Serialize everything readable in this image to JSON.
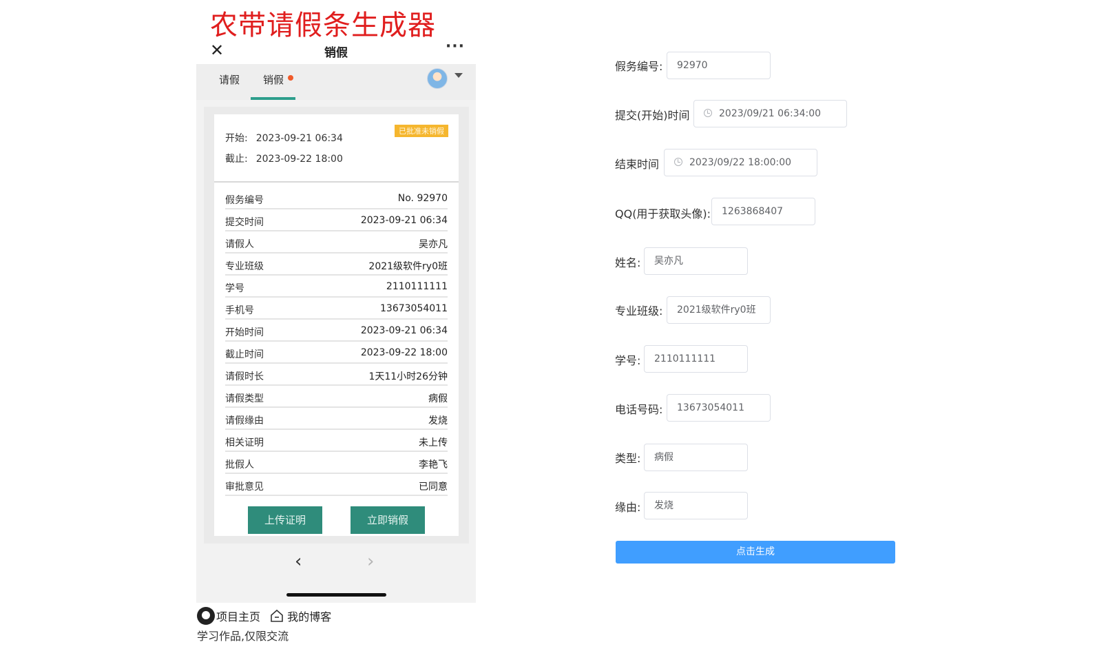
{
  "app": {
    "title": "农带请假条生成器"
  },
  "wechat_bar": {
    "close_icon": "close-icon",
    "title": "销假",
    "more": "···"
  },
  "tabs": [
    {
      "label": "请假"
    },
    {
      "label": "销假",
      "has_dot": true,
      "active": true
    }
  ],
  "card": {
    "start_label": "开始:",
    "start_value": "2023-09-21 06:34",
    "end_label": "截止:",
    "end_value": "2023-09-22 18:00",
    "status_badge": "已批准未销假",
    "rows": [
      {
        "label": "假务编号",
        "value": "No. 92970"
      },
      {
        "label": "提交时间",
        "value": "2023-09-21  06:34"
      },
      {
        "label": "请假人",
        "value": "吴亦凡"
      },
      {
        "label": "专业班级",
        "value": "2021级软件ry0班"
      },
      {
        "label": "学号",
        "value": "2110111111"
      },
      {
        "label": "手机号",
        "value": "13673054011"
      },
      {
        "label": "开始时间",
        "value": "2023-09-21  06:34"
      },
      {
        "label": "截止时间",
        "value": "2023-09-22  18:00"
      },
      {
        "label": "请假时长",
        "value": "1天11小时26分钟"
      },
      {
        "label": "请假类型",
        "value": "病假"
      },
      {
        "label": "请假缘由",
        "value": "发烧"
      },
      {
        "label": "相关证明",
        "value": "未上传"
      },
      {
        "label": "批假人",
        "value": "李艳飞"
      },
      {
        "label": "审批意见",
        "value": "已同意"
      }
    ],
    "upload_button": "上传证明",
    "cancel_leave_button": "立即销假"
  },
  "nav": {
    "back": "‹",
    "forward": "›"
  },
  "footer": {
    "project_link": "项目主页",
    "blog_link": "我的博客",
    "disclaimer": "学习作品,仅限交流"
  },
  "form": {
    "leave_no": {
      "label": "假务编号:",
      "value": "92970"
    },
    "submit_time": {
      "label": "提交(开始)时间",
      "value": "2023/09/21 06:34:00"
    },
    "end_time": {
      "label": "结束时间",
      "value": "2023/09/22 18:00:00"
    },
    "qq": {
      "label": "QQ(用于获取头像):",
      "value": "1263868407"
    },
    "name": {
      "label": "姓名:",
      "value": "吴亦凡"
    },
    "class": {
      "label": "专业班级:",
      "value": "2021级软件ry0班"
    },
    "student_id": {
      "label": "学号:",
      "value": "2110111111"
    },
    "phone": {
      "label": "电话号码:",
      "value": "13673054011"
    },
    "type": {
      "label": "类型:",
      "value": "病假"
    },
    "reason": {
      "label": "缘由:",
      "value": "发烧"
    },
    "generate_button": "点击生成"
  },
  "colors": {
    "title_red": "#e01e1e",
    "accent_green": "#2f8c7b",
    "badge_orange": "#f5b62e",
    "primary_blue": "#409eff"
  }
}
